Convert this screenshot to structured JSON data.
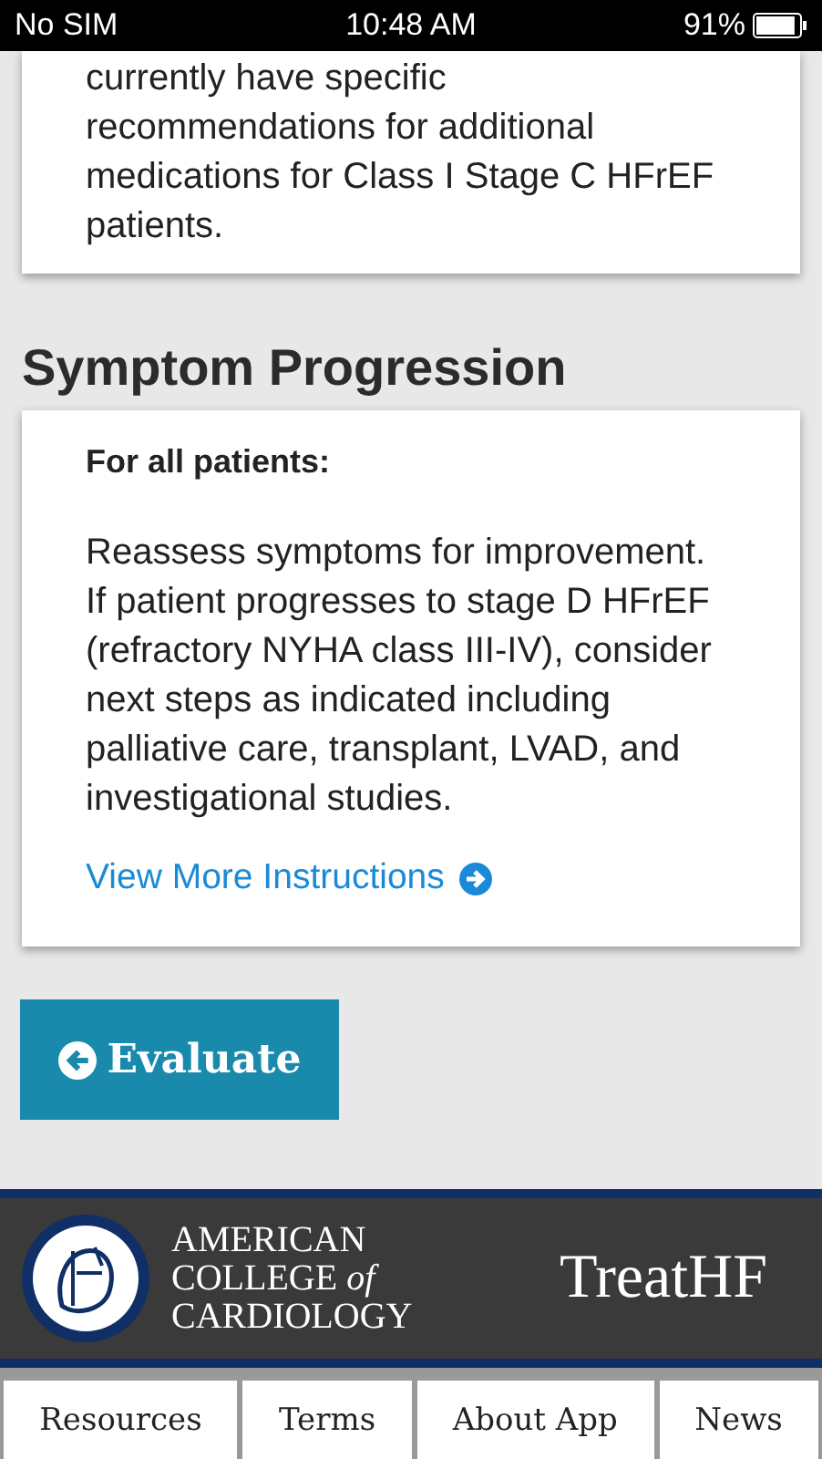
{
  "status_bar": {
    "carrier": "No SIM",
    "time": "10:48 AM",
    "battery": "91%",
    "level": 0.91
  },
  "previous_card": {
    "text": "currently have specific recommendations for additional medications for Class I Stage C HFrEF patients."
  },
  "section": {
    "title": "Symptom Progression",
    "subtitle": "For all patients:",
    "text": "Reassess symptoms for improvement. If patient progresses to stage D HFrEF (refractory NYHA class III-IV), consider next steps as indicated including palliative care, transplant, LVAD, and investigational studies.",
    "link": "View More Instructions"
  },
  "evaluate_button": "Evaluate",
  "footer": {
    "org_lines": [
      "AMERICAN",
      "COLLEGE *of*",
      "CARDIOLOGY"
    ],
    "app_name": "TreatHF"
  },
  "nav_tabs": [
    {
      "label": "Resources"
    },
    {
      "label": "Terms"
    },
    {
      "label": "About App"
    },
    {
      "label": "News"
    }
  ]
}
